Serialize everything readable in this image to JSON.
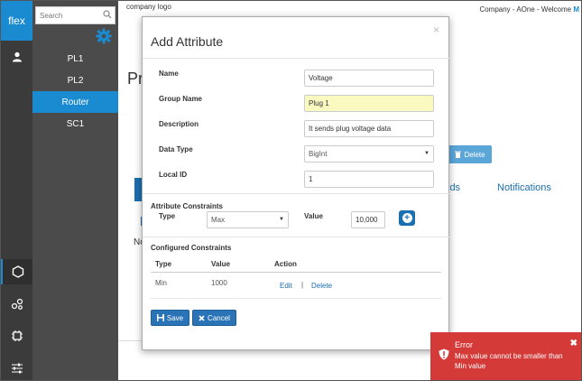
{
  "rail": {
    "brand": "flex",
    "icons": [
      "user-icon",
      "hexagon-icon",
      "cluster-icon",
      "chip-icon",
      "sliders-icon"
    ]
  },
  "nav": {
    "search_placeholder": "Search",
    "items": [
      {
        "label": "PL1"
      },
      {
        "label": "PL2"
      },
      {
        "label": "Router"
      },
      {
        "label": "SC1"
      }
    ]
  },
  "header": {
    "logo": "company logo",
    "company": "Company - AOne - Welcome ",
    "user_initial": "M"
  },
  "page": {
    "title_fragment": "Pr",
    "delete_label": "Delete",
    "tab_fragment": "lds",
    "tab_notifications": "Notifications",
    "no_fragment": "No"
  },
  "modal": {
    "title": "Add Attribute",
    "close": "×",
    "fields": {
      "name_label": "Name",
      "name_value": "Voltage",
      "group_label": "Group Name",
      "group_value": "Plug 1",
      "desc_label": "Description",
      "desc_value": "It sends plug voltage data",
      "type_label": "Data Type",
      "type_value": "BigInt",
      "localid_label": "Local ID",
      "localid_value": "1"
    },
    "constraints": {
      "heading": "Attribute Constraints",
      "type_label": "Type",
      "type_value": "Max",
      "value_label": "Value",
      "value_value": "10,000"
    },
    "configured": {
      "heading": "Configured Constraints",
      "col_type": "Type",
      "col_value": "Value",
      "col_action": "Action",
      "rows": [
        {
          "type": "Min",
          "value": "1000",
          "edit": "Edit",
          "sep": "|",
          "delete": "Delete"
        }
      ]
    },
    "save_label": "Save",
    "cancel_label": "Cancel"
  },
  "toast": {
    "title": "Error",
    "message": "Max value cannot be smaller than Min value",
    "close": "✖"
  },
  "colors": {
    "accent": "#1a8bd1",
    "error": "#d33a38",
    "rail": "#3b3b3b",
    "nav": "#4b4b4b"
  }
}
